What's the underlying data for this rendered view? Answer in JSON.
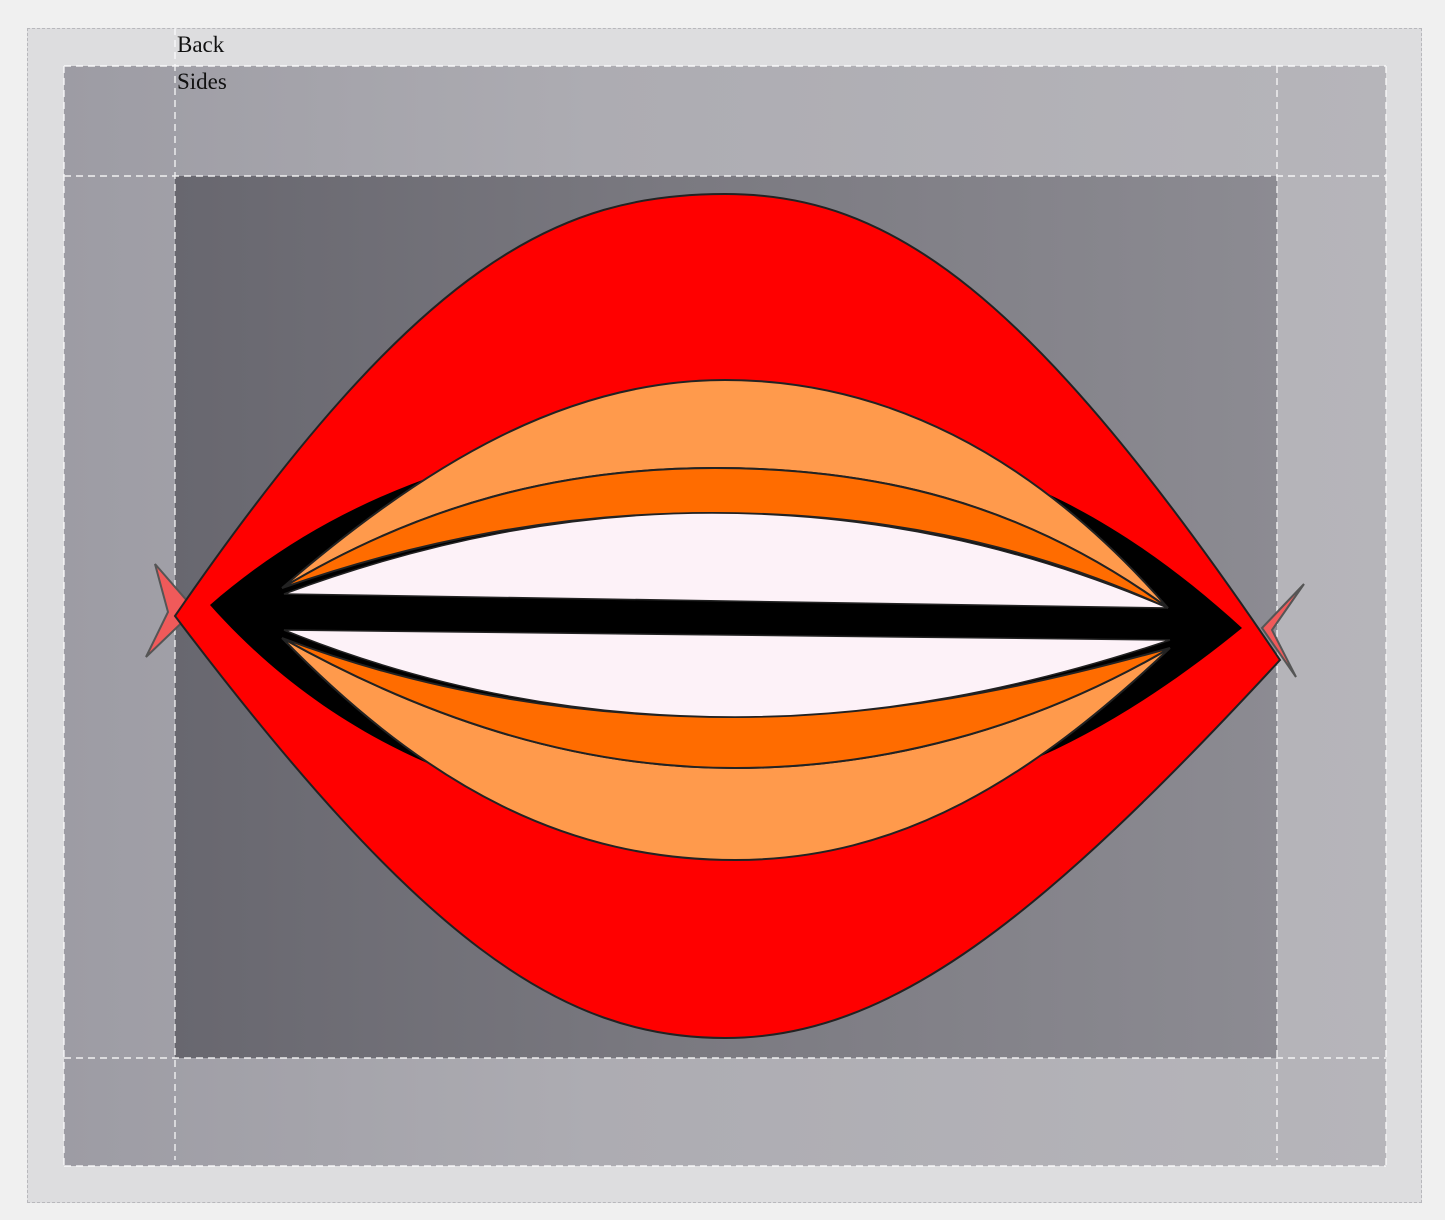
{
  "labels": {
    "back": "Back",
    "sides": "Sides"
  },
  "colors": {
    "background": "#f0f0f0",
    "outer_frame": "#dddddf",
    "sides_panel": "#adacb2",
    "back_panel": "#78777e",
    "outer_band": "#ff0000",
    "middle_band": "#ff9a4c",
    "inner_band": "#ff6c00",
    "eye_white": "#fdf2f8",
    "bar": "#000000",
    "tips": "#f05a5a",
    "guide_lines": "#ffffff"
  }
}
